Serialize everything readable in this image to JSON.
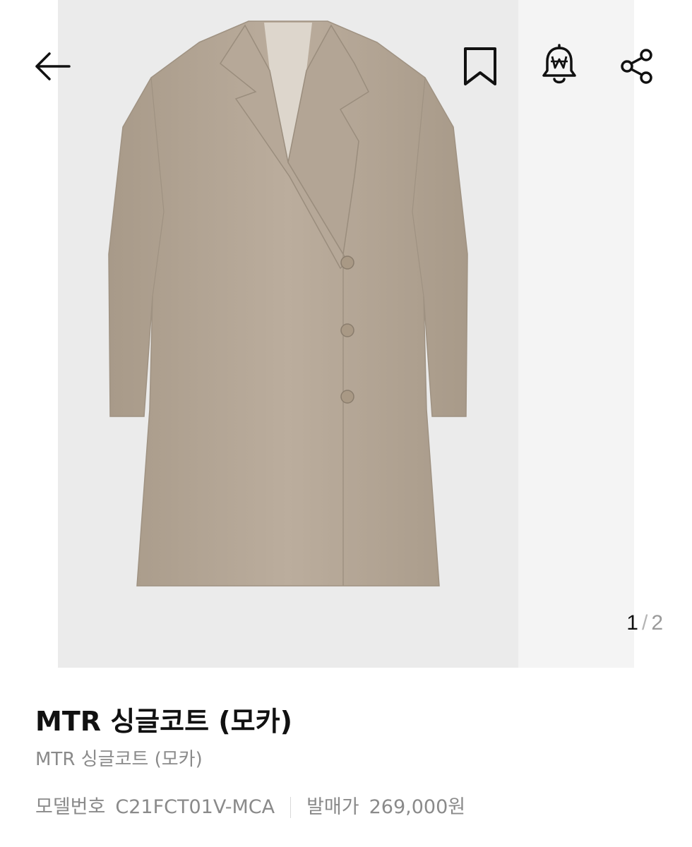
{
  "header": {
    "back_icon": "arrow-left-icon",
    "bookmark_icon": "bookmark-icon",
    "price_alert_icon": "won-bell-icon",
    "share_icon": "share-icon"
  },
  "gallery": {
    "current": "1",
    "separator": "/",
    "total": "2"
  },
  "product": {
    "title": "MTR 싱글코트 (모카)",
    "subtitle": "MTR 싱글코트 (모카)",
    "model_label": "모델번호",
    "model_value": "C21FCT01V-MCA",
    "price_label": "발매가",
    "price_value": "269,000원"
  },
  "colors": {
    "coat": "#b9ab9b",
    "background": "#ebebeb"
  }
}
